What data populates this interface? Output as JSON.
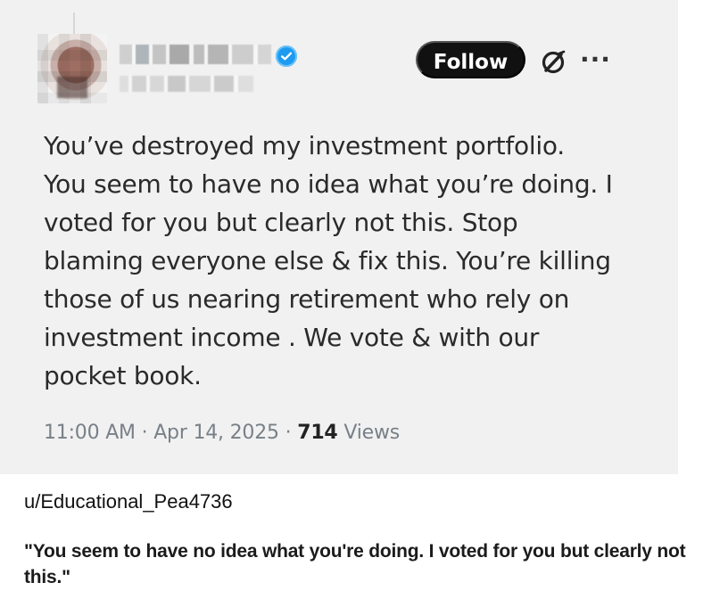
{
  "post": {
    "follow_label": "Follow",
    "more_label": "···",
    "body_lines": [
      "You’ve destroyed my investment portfolio.",
      "You seem to have no idea what you’re doing.  I",
      "voted for you but clearly not this. Stop",
      "blaming everyone else & fix this.  You’re killing",
      "those of us nearing retirement who rely on",
      "investment income .  We vote & with our",
      "pocket book."
    ],
    "timestamp": "11:00 AM · Apr 14, 2025 · ",
    "views_count": "714",
    "views_label": " Views"
  },
  "reddit": {
    "username": "u/Educational_Pea4736",
    "caption_lines": [
      "\"You seem to have no idea what you're doing. I voted for you but clearly not",
      "this.\""
    ]
  },
  "icons": {
    "avatar": "blurred-avatar",
    "verified": "verified-badge-icon",
    "grok": "grok-icon",
    "more": "more-icon"
  },
  "colors": {
    "card_background": "#f1f1f1",
    "follow_button": "#111111",
    "verified_blue": "#1d9bf0",
    "meta_gray": "#788088"
  }
}
